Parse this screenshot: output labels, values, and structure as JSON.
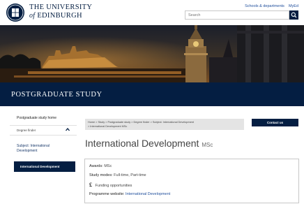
{
  "header": {
    "university_line1": "THE UNIVERSITY",
    "university_line2_of": "of",
    "university_line2": "EDINBURGH",
    "links": [
      "Schools & departments",
      "MyEd"
    ],
    "search_placeholder": "Search",
    "crest": "university-crest"
  },
  "banner": {
    "title": "POSTGRADUATE STUDY"
  },
  "sidebar": {
    "home": "Postgraduate study home",
    "finder": "Degree finder",
    "subject_line1": "Subject: International",
    "subject_line2": "Development",
    "active": "International Development"
  },
  "breadcrumb": {
    "line1": "Home  >  Study  >  Postgraduate study  >  Degree finder  >  Subject: International Development",
    "line2": ">  International Development MSc"
  },
  "contact_button": "Contact us",
  "page": {
    "title": "International Development",
    "degree": "MSc"
  },
  "info": {
    "awards_label": "Awards:",
    "awards_value": "MSc",
    "modes_label": "Study modes:",
    "modes_value": "Full-time, Part-time",
    "funding_symbol": "£",
    "funding": "Funding opportunities",
    "website_label": "Programme website:",
    "website_value": "International Development"
  },
  "colors": {
    "navy": "#041e42",
    "link": "#1f4e9c"
  }
}
